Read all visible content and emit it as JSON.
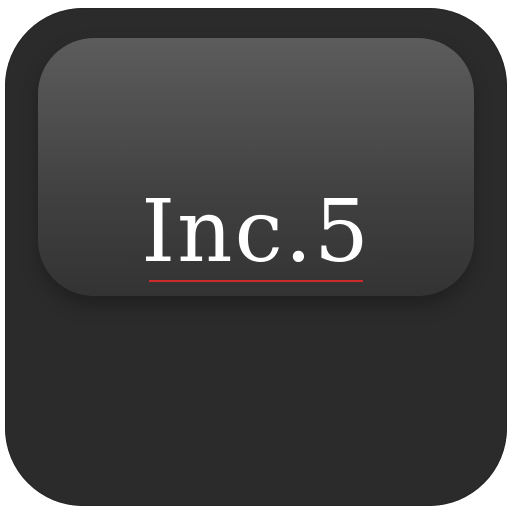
{
  "icon": {
    "wordmark": "Inc.5",
    "colors": {
      "background": "#2b2b2b",
      "gloss_top": "#5c5c5c",
      "text": "#ffffff",
      "underline": "#cc2a2a"
    }
  }
}
